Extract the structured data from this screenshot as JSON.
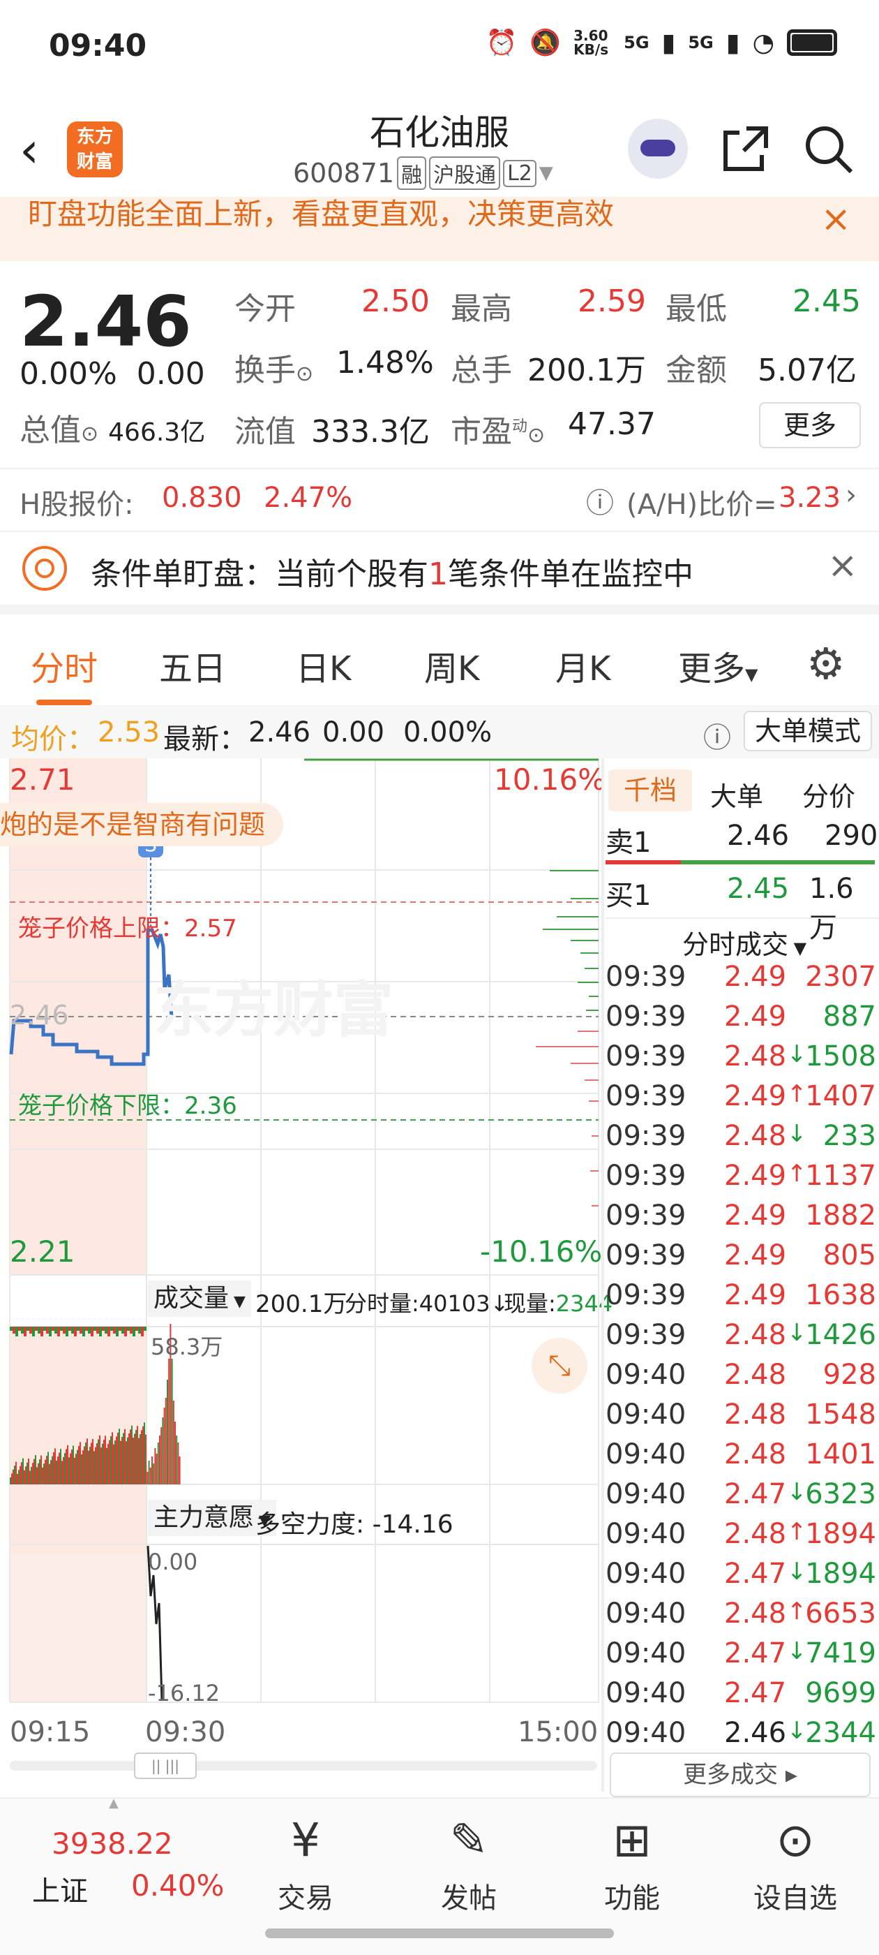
{
  "status_bar": {
    "time": "09:40",
    "net_speed": "3.60 KB/s",
    "sig1": "5G",
    "sig2": "5G",
    "alarm_icon": "alarm-icon",
    "mute_icon": "bell-off-icon",
    "wifi_icon": "wifi-icon",
    "battery_icon": "battery-icon"
  },
  "header": {
    "logo_text": "东方财富",
    "stock_name": "石化油服",
    "stock_code": "600871",
    "tags": [
      "融",
      "沪股通",
      "L2"
    ]
  },
  "banner": {
    "text": "盯盘功能全面上新，看盘更直观，决策更高效",
    "close": "×"
  },
  "quote": {
    "price": "2.46",
    "change_pct": "0.00%",
    "change": "0.00",
    "open_label": "今开",
    "open": "2.50",
    "high_label": "最高",
    "high": "2.59",
    "low_label": "最低",
    "low": "2.45",
    "turnover_label": "换手",
    "turnover": "1.48%",
    "volume_label": "总手",
    "volume": "200.1万",
    "amount_label": "金额",
    "amount": "5.07亿",
    "mktcap_label": "总值",
    "mktcap": "466.3亿",
    "float_label": "流值",
    "float_cap": "333.3亿",
    "pe_label": "市盈",
    "pe_sup": "动",
    "pe": "47.37",
    "more": "更多"
  },
  "hshare": {
    "label": "H股报价:",
    "price": "0.830",
    "pct": "2.47%",
    "ratio_label": "(A/H)比价=",
    "ratio": "3.23"
  },
  "condition": {
    "prefix": "条件单盯盘：当前个股有",
    "count": "1",
    "suffix": "笔条件单在监控中"
  },
  "tabs": [
    "分时",
    "五日",
    "日K",
    "周K",
    "月K",
    "更多"
  ],
  "avgbar": {
    "avg_label": "均价：",
    "avg": "2.53",
    "latest_label": "最新：",
    "latest": "2.46",
    "chg": "0.00",
    "pct": "0.00%",
    "mode": "大单模式"
  },
  "chart": {
    "y_top": "2.71",
    "y_top_pct": "10.16%",
    "y_bottom": "2.21",
    "y_bottom_pct": "-10.16%",
    "mid": "2.46",
    "bubble": "炮的是不是智商有问题",
    "upper_limit": "笼子价格上限：2.57",
    "lower_limit": "笼子价格下限：2.36",
    "watermark": "东方财富",
    "vol_label": "成交量",
    "vol_total": "200.1万",
    "vol_tick": "分时量:40103↓",
    "vol_now_label": "现量:",
    "vol_now": "2344",
    "vol_max": "58.3万",
    "ind_label": "主力意愿",
    "ind_value": "多空力度: -14.16",
    "ind_top": "0.00",
    "ind_bottom": "-16.12",
    "x_start": "09:15",
    "x_mid": "09:30",
    "x_end": "15:00",
    "s_marker": "S"
  },
  "orderbook": {
    "tabs": [
      "千档",
      "大单",
      "分价"
    ],
    "ask_label": "卖1",
    "ask_price": "2.46",
    "ask_vol": "290",
    "bid_label": "买1",
    "bid_price": "2.45",
    "bid_vol": "1.6万",
    "trades_title": "分时成交",
    "more_trades": "更多成交",
    "trades": [
      {
        "t": "09:39",
        "p": "2.49",
        "a": "",
        "v": "2307",
        "c": "red"
      },
      {
        "t": "09:39",
        "p": "2.49",
        "a": "",
        "v": "887",
        "c": "green"
      },
      {
        "t": "09:39",
        "p": "2.48",
        "a": "↓",
        "v": "1508",
        "c": "green"
      },
      {
        "t": "09:39",
        "p": "2.49",
        "a": "↑",
        "v": "1407",
        "c": "red"
      },
      {
        "t": "09:39",
        "p": "2.48",
        "a": "↓",
        "v": "233",
        "c": "green"
      },
      {
        "t": "09:39",
        "p": "2.49",
        "a": "↑",
        "v": "1137",
        "c": "red"
      },
      {
        "t": "09:39",
        "p": "2.49",
        "a": "",
        "v": "1882",
        "c": "red"
      },
      {
        "t": "09:39",
        "p": "2.49",
        "a": "",
        "v": "805",
        "c": "red"
      },
      {
        "t": "09:39",
        "p": "2.49",
        "a": "",
        "v": "1638",
        "c": "red"
      },
      {
        "t": "09:39",
        "p": "2.48",
        "a": "↓",
        "v": "1426",
        "c": "green"
      },
      {
        "t": "09:40",
        "p": "2.48",
        "a": "",
        "v": "928",
        "c": "red"
      },
      {
        "t": "09:40",
        "p": "2.48",
        "a": "",
        "v": "1548",
        "c": "red"
      },
      {
        "t": "09:40",
        "p": "2.48",
        "a": "",
        "v": "1401",
        "c": "red"
      },
      {
        "t": "09:40",
        "p": "2.47",
        "a": "↓",
        "v": "6323",
        "c": "green"
      },
      {
        "t": "09:40",
        "p": "2.48",
        "a": "↑",
        "v": "1894",
        "c": "red"
      },
      {
        "t": "09:40",
        "p": "2.47",
        "a": "↓",
        "v": "1894",
        "c": "green"
      },
      {
        "t": "09:40",
        "p": "2.48",
        "a": "↑",
        "v": "6653",
        "c": "red"
      },
      {
        "t": "09:40",
        "p": "2.47",
        "a": "↓",
        "v": "7419",
        "c": "green"
      },
      {
        "t": "09:40",
        "p": "2.47",
        "a": "",
        "v": "9699",
        "c": "green"
      },
      {
        "t": "09:40",
        "p": "2.46",
        "a": "↓",
        "v": "2344",
        "c": "green"
      }
    ]
  },
  "bottom_nav": {
    "index_value": "3938.22",
    "index_name": "上证",
    "index_pct": "0.40%",
    "items": [
      {
        "label": "交易",
        "icon": "yen-refresh-icon"
      },
      {
        "label": "发帖",
        "icon": "edit-post-icon"
      },
      {
        "label": "功能",
        "icon": "grid-apps-icon"
      },
      {
        "label": "设自选",
        "icon": "more-circle-icon"
      }
    ]
  }
}
